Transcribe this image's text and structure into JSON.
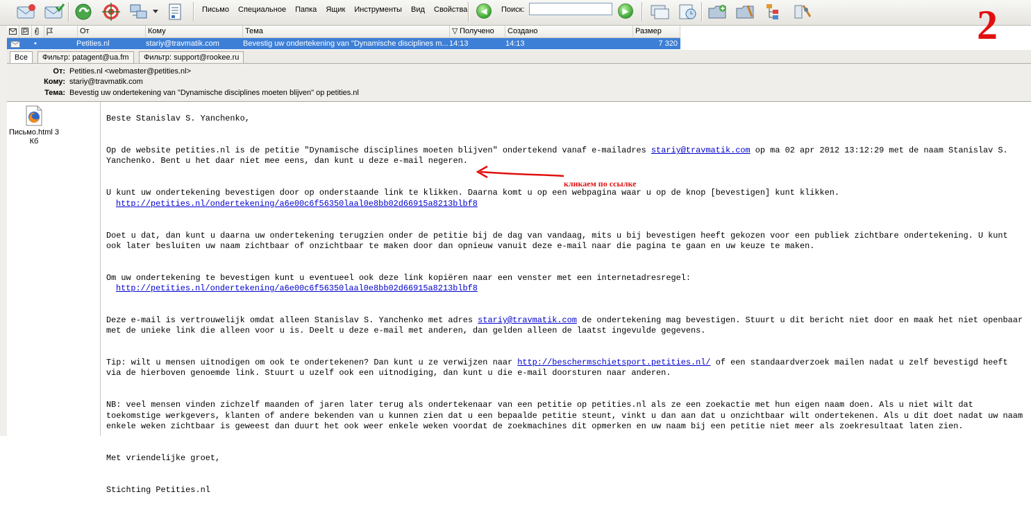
{
  "toolbar": {
    "menu": [
      "Письмо",
      "Специальное",
      "Папка",
      "Ящик",
      "Инструменты",
      "Вид",
      "Свойства",
      "?"
    ],
    "search_label": "Поиск:",
    "search_value": "",
    "icons": [
      "envelope-receive-icon",
      "envelope-check-icon",
      "recycle-icon",
      "target-icon",
      "network-icon",
      "book-icon",
      "back-arrow-icon",
      "forward-arrow-icon",
      "messages-icon",
      "clock-note-icon",
      "new-folder-icon",
      "folder-tools-icon",
      "tree-icon",
      "settings-tools-icon"
    ]
  },
  "overlay_number": "2",
  "list": {
    "columns": [
      "От",
      "Кому",
      "Тема",
      "Получено",
      "Создано",
      "Размер"
    ],
    "rows": [
      {
        "from": "Petities.nl",
        "to": "stariy@travmatik.com",
        "subject": "Bevestig uw ondertekening van \"Dynamische disciplines m...",
        "received": "14:13",
        "created": "14:13",
        "size": "7 320"
      }
    ]
  },
  "tabs": [
    "Все",
    "Фильтр: patagent@ua.fm",
    "Фильтр: support@rookee.ru"
  ],
  "header": {
    "from_label": "От:",
    "from": "Petities.nl <webmaster@petities.nl>",
    "to_label": "Кому:",
    "to": "stariy@travmatik.com",
    "subject_label": "Тема:",
    "subject": "Bevestig uw ondertekening van \"Dynamische disciplines moeten blijven\" op petities.nl"
  },
  "attachment": {
    "name": "Письмо.html 3 Кб"
  },
  "body": {
    "greeting": "Beste Stanislav S. Yanchenko,",
    "p1_a": "Op de website petities.nl is de petitie \"Dynamische disciplines moeten blijven\" ondertekend vanaf e-mailadres ",
    "p1_link": "stariy@travmatik.com",
    "p1_b": " op ma 02 apr 2012 13:12:29 met de naam Stanislav S. Yanchenko. Bent u het daar niet mee eens, dan kunt u deze e-mail negeren.",
    "p2": "U kunt uw ondertekening bevestigen door op onderstaande link te klikken. Daarna komt u op een webpagina waar u op de knop [bevestigen] kunt klikken.",
    "p2_link": "http://petities.nl/ondertekening/a6e00c6f56350laal0e8bb02d66915a8213blbf8",
    "p3": "Doet u dat, dan kunt u daarna uw ondertekening terugzien onder de petitie bij de dag van vandaag, mits u bij bevestigen heeft gekozen voor een publiek zichtbare ondertekening. U kunt ook later besluiten uw naam zichtbaar of onzichtbaar te maken door dan opnieuw vanuit deze e-mail naar die pagina te gaan en uw keuze te maken.",
    "p4": "Om uw ondertekening te bevestigen kunt u eventueel ook deze link kopiëren naar een venster met een internetadresregel:",
    "p4_link": "http://petities.nl/ondertekening/a6e00c6f56350laal0e8bb02d66915a8213blbf8",
    "p5_a": "Deze e-mail is vertrouwelijk omdat alleen Stanislav S. Yanchenko met adres ",
    "p5_link": "stariy@travmatik.com",
    "p5_b": " de ondertekening mag bevestigen. Stuurt u dit bericht niet door en maak het niet openbaar met de unieke link die alleen voor u is. Deelt u deze e-mail met anderen, dan gelden alleen de laatst ingevulde gegevens.",
    "p6_a": "Tip: wilt u mensen uitnodigen om ook te ondertekenen? Dan kunt u ze verwijzen naar ",
    "p6_link": "http://beschermschietsport.petities.nl/",
    "p6_b": " of een standaardverzoek mailen nadat u zelf bevestigd heeft via de hierboven genoemde link. Stuurt u uzelf ook een uitnodiging, dan kunt u die e-mail doorsturen naar anderen.",
    "p7": "NB: veel mensen vinden zichzelf maanden of jaren later terug als ondertekenaar van een petitie op petities.nl als ze een zoekactie met hun eigen naam doen. Als u niet wilt dat toekomstige werkgevers, klanten of andere bekenden van u kunnen zien dat u een bepaalde petitie steunt, vinkt u dan aan dat u onzichtbaar wilt ondertekenen. Als u dit doet nadat uw naam enkele weken zichtbaar is geweest dan duurt het ook weer enkele weken voordat de zoekmachines dit opmerken en uw naam bij een petitie niet meer als zoekresultaat laten zien.",
    "closing": "Met vriendelijke groet,",
    "signature": "Stichting Petities.nl"
  },
  "annotation": "кликаем по ссылке",
  "colors": {
    "selection": "#3d7fd6",
    "link": "#0000cc",
    "annotation": "#e01010"
  }
}
